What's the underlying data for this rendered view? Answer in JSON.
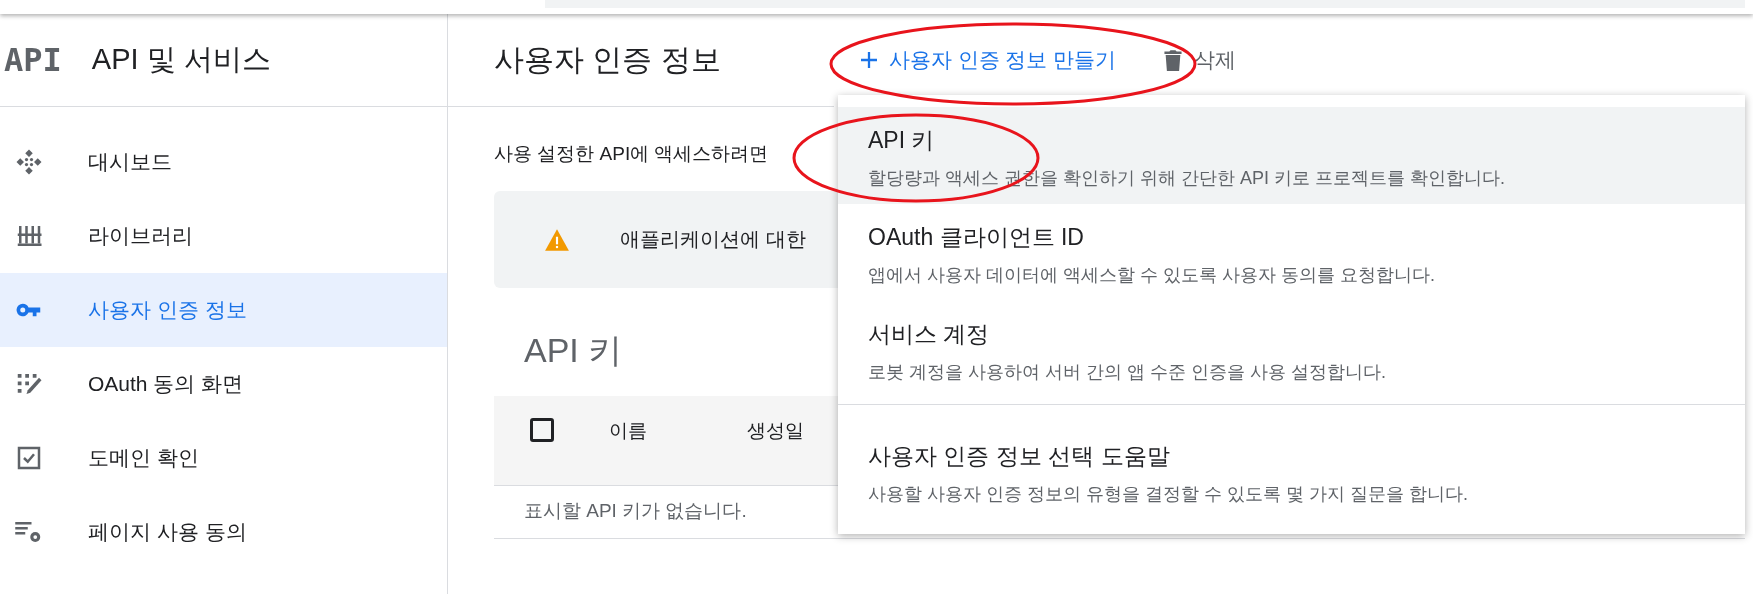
{
  "sidebar": {
    "logo": "API",
    "title": "API 및 서비스",
    "items": [
      {
        "label": "대시보드",
        "selected": false
      },
      {
        "label": "라이브러리",
        "selected": false
      },
      {
        "label": "사용자 인증 정보",
        "selected": true
      },
      {
        "label": "OAuth 동의 화면",
        "selected": false
      },
      {
        "label": "도메인 확인",
        "selected": false
      },
      {
        "label": "페이지 사용 동의",
        "selected": false
      }
    ]
  },
  "header": {
    "title": "사용자 인증 정보",
    "create_button": "사용자 인증 정보 만들기",
    "delete_button": "삭제"
  },
  "intro": "사용 설정한 API에 액세스하려면",
  "warning": "애플리케이션에 대한",
  "api_keys": {
    "heading": "API 키",
    "columns": [
      "이름",
      "생성일"
    ],
    "select_all_checked": false,
    "empty_message": "표시할 API 키가 없습니다."
  },
  "menu": {
    "items": [
      {
        "title": "API 키",
        "description": "할당량과 액세스 권한을 확인하기 위해 간단한 API 키로 프로젝트를 확인합니다.",
        "selected": true
      },
      {
        "title": "OAuth 클라이언트 ID",
        "description": "앱에서 사용자 데이터에 액세스할 수 있도록 사용자 동의를 요청합니다.",
        "selected": false
      },
      {
        "title": "서비스 계정",
        "description": "로봇 계정을 사용하여 서버 간의 앱 수준 인증을 사용 설정합니다.",
        "selected": false
      },
      {
        "title": "사용자 인증 정보 선택 도움말",
        "description": "사용할 사용자 인증 정보의 유형을 결정할 수 있도록 몇 가지 질문을 합니다.",
        "selected": false,
        "divider_before": true
      }
    ]
  }
}
